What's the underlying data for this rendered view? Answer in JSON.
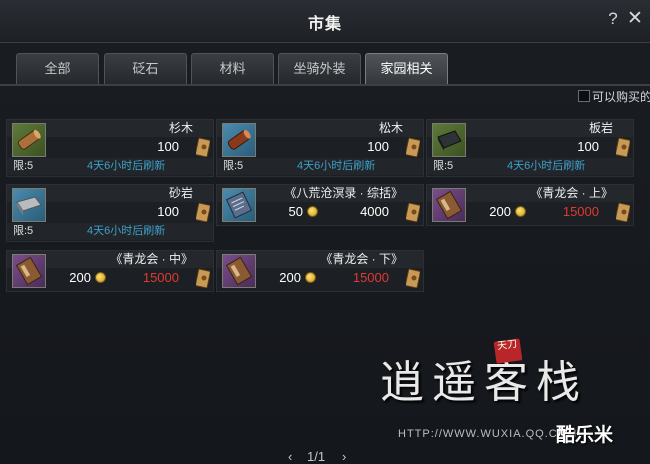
{
  "window": {
    "title": "市集",
    "help": "?",
    "close": "✕"
  },
  "tabs": [
    {
      "label": "全部",
      "active": false
    },
    {
      "label": "砭石",
      "active": false
    },
    {
      "label": "材料",
      "active": false
    },
    {
      "label": "坐骑外装",
      "active": false
    },
    {
      "label": "家园相关",
      "active": true
    }
  ],
  "filter": {
    "label": "可以购买的",
    "checked": false
  },
  "items": [
    {
      "name": "杉木",
      "price": "100",
      "currency_icon": "ticket-icon",
      "limit": "限:5",
      "refresh": "4天6小时后刷新",
      "icon": "wood-log-icon",
      "rarity_color": "#5e7a3a"
    },
    {
      "name": "松木",
      "price": "100",
      "currency_icon": "ticket-icon",
      "limit": "限:5",
      "refresh": "4天6小时后刷新",
      "icon": "wood-log-icon",
      "rarity_color": "#4a8cae"
    },
    {
      "name": "板岩",
      "price": "100",
      "currency_icon": "ticket-icon",
      "limit": "限:5",
      "refresh": "4天6小时后刷新",
      "icon": "slate-stone-icon",
      "rarity_color": "#5e7a3a"
    },
    {
      "name": "砂岩",
      "price": "100",
      "currency_icon": "ticket-icon",
      "limit": "限:5",
      "refresh": "4天6小时后刷新",
      "icon": "sandstone-icon",
      "rarity_color": "#4a8cae"
    },
    {
      "name": "《八荒沧溟录 · 综括》",
      "coin": "50",
      "price": "4000",
      "currency_icon": "ticket-icon",
      "icon": "book-icon",
      "rarity_color": "#4a8cae"
    },
    {
      "name": "《青龙会 · 上》",
      "coin": "200",
      "price": "15000",
      "price_color": "#e03a32",
      "currency_icon": "ticket-icon",
      "icon": "book-icon",
      "rarity_color": "#7a4e8a"
    },
    {
      "name": "《青龙会 · 中》",
      "coin": "200",
      "price": "15000",
      "price_color": "#e03a32",
      "currency_icon": "ticket-icon",
      "icon": "book-icon",
      "rarity_color": "#7a4e8a"
    },
    {
      "name": "《青龙会 · 下》",
      "coin": "200",
      "price": "15000",
      "price_color": "#e03a32",
      "currency_icon": "ticket-icon",
      "icon": "book-icon",
      "rarity_color": "#7a4e8a"
    }
  ],
  "pager": {
    "prev": "‹",
    "text": "1/1",
    "next": "›"
  },
  "watermark": {
    "title": "逍遥客栈",
    "stamp": "天刀",
    "url": "HTTP://WWW.WUXIA.QQ.COM",
    "logo": "酷乐米"
  }
}
